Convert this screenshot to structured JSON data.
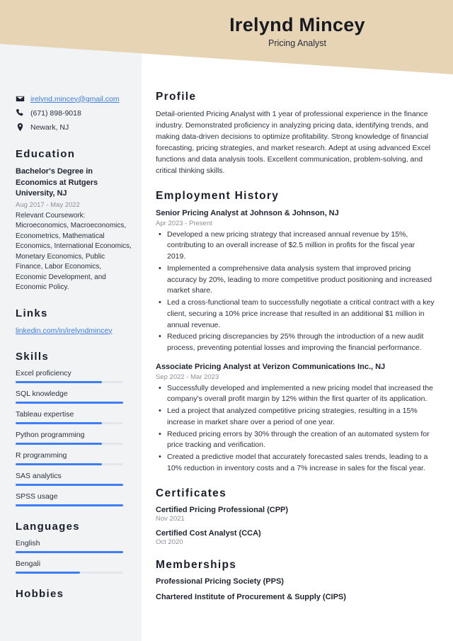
{
  "header": {
    "name": "Irelynd Mincey",
    "job_title": "Pricing Analyst",
    "band_color": "#e7d4b5"
  },
  "theme": {
    "sidebar_bg": "#f1f3f5",
    "accent": "#3d7ef5",
    "link": "#3e7de0",
    "text": "#2b313d",
    "muted": "#8b9099"
  },
  "sidebar": {
    "contact": [
      {
        "icon": "envelope-icon",
        "text": "irelynd.mincey@gmail.com",
        "is_link": true
      },
      {
        "icon": "phone-icon",
        "text": "(671) 898-9018",
        "is_link": false
      },
      {
        "icon": "location-pin-icon",
        "text": "Newark, NJ",
        "is_link": false
      }
    ],
    "education": {
      "heading": "Education",
      "degree": "Bachelor's Degree in Economics at Rutgers University, NJ",
      "date": "Aug 2017 - May 2022",
      "coursework": "Relevant Coursework: Microeconomics, Macroeconomics, Econometrics, Mathematical Economics, International Economics, Monetary Economics, Public Finance, Labor Economics, Economic Development, and Economic Policy."
    },
    "links": {
      "heading": "Links",
      "items": [
        {
          "label": "linkedin.com/in/irelyndmincey"
        }
      ]
    },
    "skills": {
      "heading": "Skills",
      "items": [
        {
          "label": "Excel proficiency",
          "level": 80
        },
        {
          "label": "SQL knowledge",
          "level": 100
        },
        {
          "label": "Tableau expertise",
          "level": 80
        },
        {
          "label": "Python programming",
          "level": 80
        },
        {
          "label": "R programming",
          "level": 80
        },
        {
          "label": "SAS analytics",
          "level": 100
        },
        {
          "label": "SPSS usage",
          "level": 100
        }
      ]
    },
    "languages": {
      "heading": "Languages",
      "items": [
        {
          "label": "English",
          "level": 100
        },
        {
          "label": "Bengali",
          "level": 60
        }
      ]
    },
    "hobbies": {
      "heading": "Hobbies"
    }
  },
  "main": {
    "profile": {
      "heading": "Profile",
      "text": "Detail-oriented Pricing Analyst with 1 year of professional experience in the finance industry. Demonstrated proficiency in analyzing pricing data, identifying trends, and making data-driven decisions to optimize profitability. Strong knowledge of financial forecasting, pricing strategies, and market research. Adept at using advanced Excel functions and data analysis tools. Excellent communication, problem-solving, and critical thinking skills."
    },
    "employment": {
      "heading": "Employment History",
      "jobs": [
        {
          "title": "Senior Pricing Analyst at Johnson & Johnson, NJ",
          "date": "Apr 2023 - Present",
          "bullets": [
            "Developed a new pricing strategy that increased annual revenue by 15%, contributing to an overall increase of $2.5 million in profits for the fiscal year 2019.",
            "Implemented a comprehensive data analysis system that improved pricing accuracy by 20%, leading to more competitive product positioning and increased market share.",
            "Led a cross-functional team to successfully negotiate a critical contract with a key client, securing a 10% price increase that resulted in an additional $1 million in annual revenue.",
            "Reduced pricing discrepancies by 25% through the introduction of a new audit process, preventing potential losses and improving the financial performance."
          ]
        },
        {
          "title": "Associate Pricing Analyst at Verizon Communications Inc., NJ",
          "date": "Sep 2022 - Mar 2023",
          "bullets": [
            "Successfully developed and implemented a new pricing model that increased the company's overall profit margin by 12% within the first quarter of its application.",
            "Led a project that analyzed competitive pricing strategies, resulting in a 15% increase in market share over a period of one year.",
            "Reduced pricing errors by 30% through the creation of an automated system for price tracking and verification.",
            "Created a predictive model that accurately forecasted sales trends, leading to a 10% reduction in inventory costs and a 7% increase in sales for the fiscal year."
          ]
        }
      ]
    },
    "certificates": {
      "heading": "Certificates",
      "items": [
        {
          "title": "Certified Pricing Professional (CPP)",
          "date": "Nov 2021"
        },
        {
          "title": "Certified Cost Analyst (CCA)",
          "date": "Oct 2020"
        }
      ]
    },
    "memberships": {
      "heading": "Memberships",
      "items": [
        {
          "title": "Professional Pricing Society (PPS)"
        },
        {
          "title": "Chartered Institute of Procurement & Supply (CIPS)"
        }
      ]
    }
  }
}
